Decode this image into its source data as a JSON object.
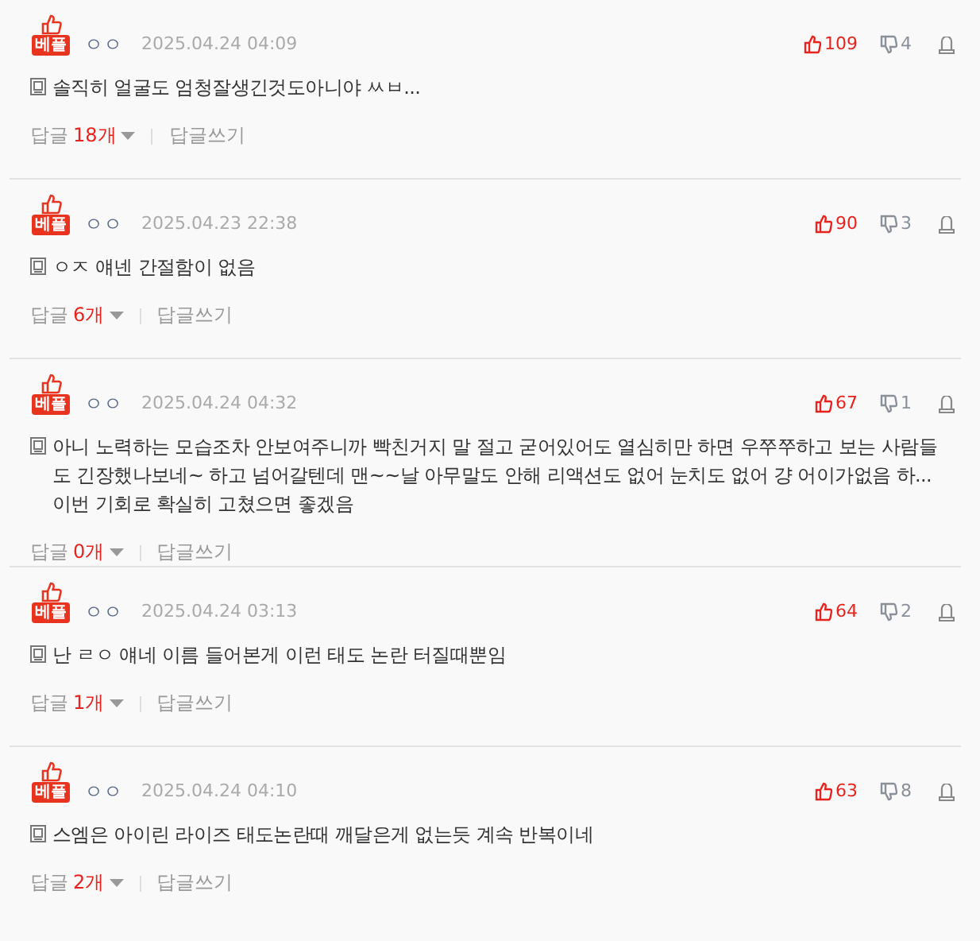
{
  "comments": [
    {
      "badge": "베플",
      "nickname": "ㅇㅇ",
      "date": "2025.04.24 04:09",
      "likes": "109",
      "dislikes": "4",
      "body": "솔직히 얼굴도 엄청잘생긴것도아니야 ㅆㅂ...",
      "reply_label": "답글",
      "reply_count": "18개",
      "write_reply": "답글쓰기"
    },
    {
      "badge": "베플",
      "nickname": "ㅇㅇ",
      "date": "2025.04.23 22:38",
      "likes": "90",
      "dislikes": "3",
      "body": "ㅇㅈ 얘넨 간절함이 없음",
      "reply_label": "답글",
      "reply_count": "6개",
      "write_reply": "답글쓰기"
    },
    {
      "badge": "베플",
      "nickname": "ㅇㅇ",
      "date": "2025.04.24 04:32",
      "likes": "67",
      "dislikes": "1",
      "body": "아니 노력하는 모습조차 안보여주니까 빡친거지 말 절고 굳어있어도 열심히만 하면 우쭈쭈하고 보는 사람들도 긴장했나보네~ 하고 넘어갈텐데 맨~~날 아무말도 안해 리액션도 없어 눈치도 없어 걍 어이가없음 하...\n이번 기회로 확실히 고쳤으면 좋겠음",
      "reply_label": "답글",
      "reply_count": "0개",
      "write_reply": "답글쓰기"
    },
    {
      "badge": "베플",
      "nickname": "ㅇㅇ",
      "date": "2025.04.24 03:13",
      "likes": "64",
      "dislikes": "2",
      "body": "난 ㄹㅇ 얘네 이름 들어본게 이런 태도 논란 터질때뿐임",
      "reply_label": "답글",
      "reply_count": "1개",
      "write_reply": "답글쓰기"
    },
    {
      "badge": "베플",
      "nickname": "ㅇㅇ",
      "date": "2025.04.24 04:10",
      "likes": "63",
      "dislikes": "8",
      "body": "스엠은 아이린 라이즈 태도논란때 깨달은게 없는듯 계속 반복이네",
      "reply_label": "답글",
      "reply_count": "2개",
      "write_reply": "답글쓰기"
    }
  ]
}
